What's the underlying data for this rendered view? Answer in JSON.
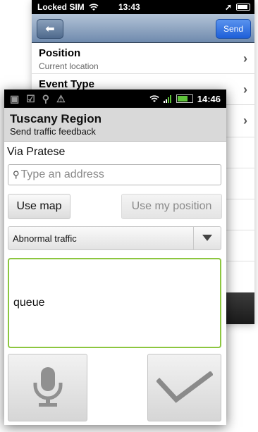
{
  "ios": {
    "status": {
      "carrier": "Locked SIM",
      "time": "13:43"
    },
    "nav": {
      "send_label": "Send"
    },
    "rows": [
      {
        "title": "Position",
        "subtitle": "Current location"
      },
      {
        "title": "Event Type",
        "subtitle": ""
      }
    ]
  },
  "android": {
    "status": {
      "time": "14:46"
    },
    "header": {
      "title": "Tuscany Region",
      "subtitle": "Send traffic feedback"
    },
    "street": "Via Pratese",
    "search": {
      "placeholder": "Type an address"
    },
    "buttons": {
      "use_map": "Use map",
      "use_position": "Use my position"
    },
    "event_select": {
      "selected": "Abnormal traffic"
    },
    "message": {
      "value": "queue"
    }
  },
  "colors": {
    "accent_green": "#8cc63f",
    "ios_nav": "#6f8aad",
    "send_blue": "#1e5fd8"
  },
  "icons": [
    "wifi-icon",
    "battery-icon",
    "location-arrow-icon",
    "back-arrow-icon",
    "chevron-right-icon",
    "search-icon",
    "dropdown-arrow-icon",
    "microphone-icon",
    "checkmark-icon",
    "usb-icon",
    "warning-icon",
    "signal-icon",
    "sim-icon"
  ]
}
